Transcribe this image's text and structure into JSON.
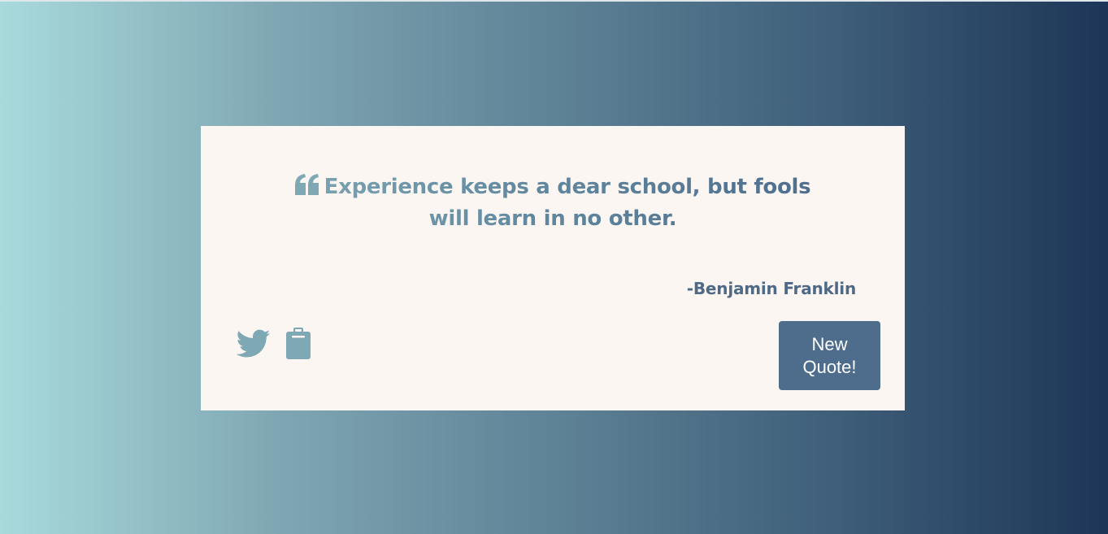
{
  "quote": {
    "icon": "quote-left-icon",
    "text": "Experience keeps a dear school, but fools will learn in no other.",
    "author": "-Benjamin Franklin"
  },
  "actions": {
    "tweet_icon": "twitter-icon",
    "copy_icon": "clipboard-icon",
    "new_quote_label": "New Quote!"
  },
  "colors": {
    "card_background": "#fbf6f2",
    "accent": "#4e6d8c",
    "icon_color": "#7fa8b5",
    "gradient_start": "#a8dadc",
    "gradient_end": "#1d3557"
  }
}
